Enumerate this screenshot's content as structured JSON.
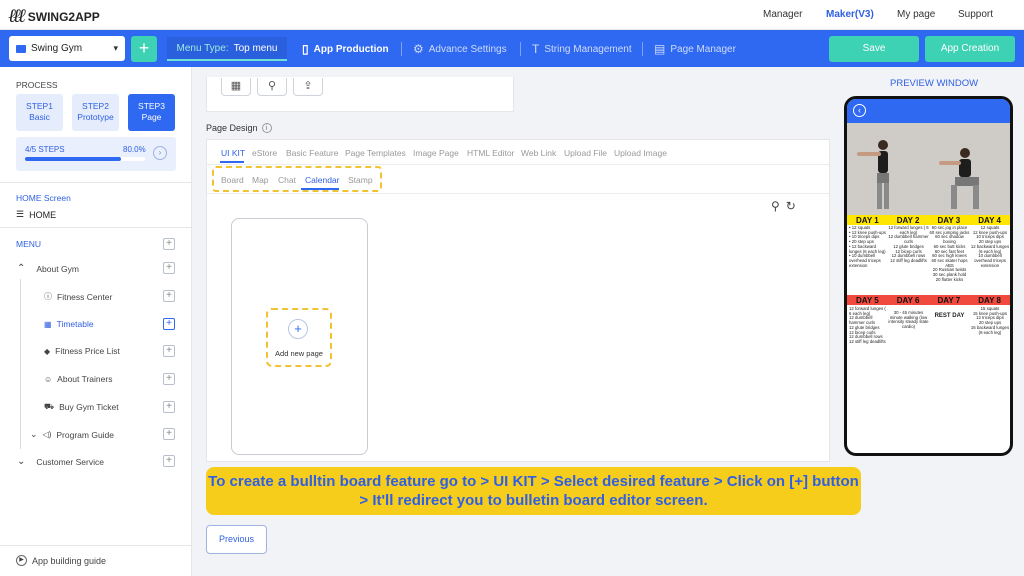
{
  "app": {
    "name": "SWING2APP"
  },
  "topnav": {
    "manager": "Manager",
    "maker": "Maker(V3)",
    "mypage": "My page",
    "support": "Support"
  },
  "toolbar": {
    "gym_select": "Swing Gym",
    "add": "+",
    "menu_type_label": "Menu Type:",
    "menu_type_value": "Top menu",
    "app_production": "App Production",
    "advanced_settings": "Advance Settings",
    "string_management": "String Management",
    "page_manager": "Page Manager",
    "save": "Save",
    "app_creation": "App Creation"
  },
  "sidebar": {
    "process_title": "PROCESS",
    "steps": [
      {
        "line1": "STEP1",
        "line2": "Basic"
      },
      {
        "line1": "STEP2",
        "line2": "Prototype"
      },
      {
        "line1": "STEP3",
        "line2": "Page"
      }
    ],
    "progress": {
      "label": "4/5 STEPS",
      "percent_text": "80.0%",
      "value": 0.8
    },
    "home_screen_title": "HOME Screen",
    "home_label": "HOME",
    "menu_title": "MENU",
    "items": [
      {
        "label": "About Gym"
      },
      {
        "label": "Fitness Center"
      },
      {
        "label": "Timetable"
      },
      {
        "label": "Fitness Price List"
      },
      {
        "label": "About Trainers"
      },
      {
        "label": "Buy Gym Ticket"
      },
      {
        "label": "Program Guide"
      },
      {
        "label": "Customer Service"
      }
    ],
    "guide": "App building guide"
  },
  "main": {
    "page_design_label": "Page Design",
    "tabs": [
      {
        "label": "UI KIT"
      },
      {
        "label": "eStore"
      },
      {
        "label": "Basic Feature"
      },
      {
        "label": "Page Templates"
      },
      {
        "label": "Image Page"
      },
      {
        "label": "HTML Editor"
      },
      {
        "label": "Web Link"
      },
      {
        "label": "Upload File"
      },
      {
        "label": "Upload Image"
      }
    ],
    "subtabs": [
      {
        "label": "Board"
      },
      {
        "label": "Map"
      },
      {
        "label": "Chat"
      },
      {
        "label": "Calendar"
      },
      {
        "label": "Stamp"
      }
    ],
    "add_page_label": "Add new page",
    "instruction": "To create a bulltin board feature go to > UI KIT > Select desired feature > Click on [+] button > It'll redirect you to bulletin board editor screen.",
    "previous": "Previous"
  },
  "preview": {
    "title": "PREVIEW WINDOW",
    "days_top": [
      "DAY 1",
      "DAY 2",
      "DAY 3",
      "DAY 4"
    ],
    "days_bottom": [
      "DAY 5",
      "DAY 6",
      "DAY 7",
      "DAY 8"
    ],
    "col_top": [
      "• 12 squats\n• 12 knee push-ups\n• 10 triceps dips\n• 20 step ups\n• 12 backward lunges (6 each leg)\n• 10 dumbbell overhead triceps extension",
      "12 forward lunges ( 6 each leg)\n12 dumbbell hammer curls\n12 glute bridges\n12 bicep curls\n12 dumbbell rows\n12 stiff leg deadlifts",
      "60 sec jog in place\n60 sec jumping jacks\n60 sec shadow boxing\n60 sec butt kicks\n60 sec fast feet\n60 sec high knees\n60 sec skater hops\nABS\n20 Russian twists\n30 sec plank hold\n20 flutter kicks",
      "12 squats\n12 knee push-ups\n10 triceps dips\n20 step ups\n12 backward lunges (6 each leg)\n10 dumbbell overhead triceps extension"
    ],
    "col_bottom": [
      "12 forward lunges ( 6 each leg)\n12 dumbbell hammer curls\n12 glute bridges\n12 bicep curls\n12 dumbbell rows\n12 stiff leg deadlifts",
      "30 - 45 minutes minute walking (low intensity steady state cardio)",
      "REST DAY",
      "15 squats\n15 knee push-ups\n12 triceps dips\n20 step ups\n16 backward lunges (8 each leg)"
    ]
  },
  "colors": {
    "brand_blue": "#2f68f1",
    "accent_green": "#3ed2b5",
    "highlight_yellow": "#f7cd1c",
    "day_yellow": "#ffe600",
    "day_red": "#f04a3f"
  }
}
